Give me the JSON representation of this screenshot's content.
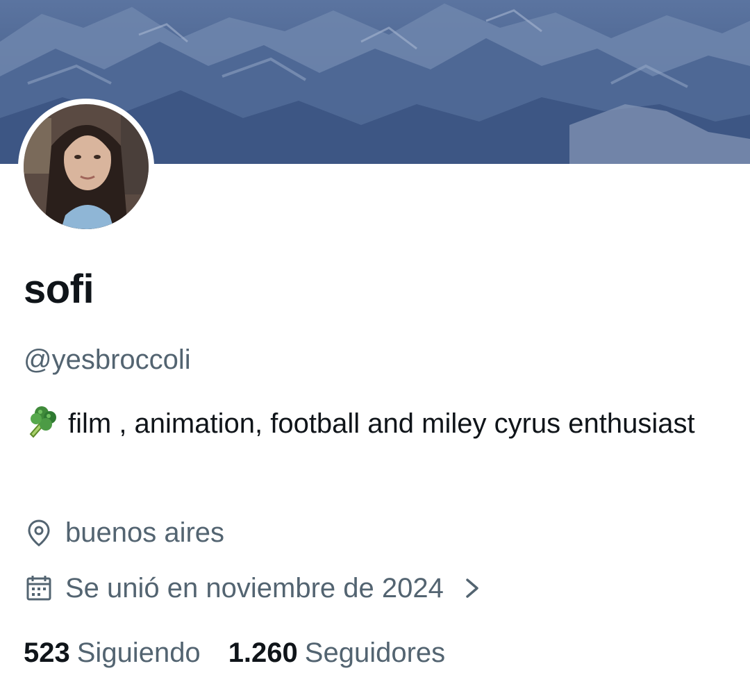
{
  "profile": {
    "display_name": "sofi",
    "handle": "@yesbroccoli",
    "bio": {
      "emoji_icon": "broccoli-emoji",
      "text": "film , animation, football and miley cyrus enthusiast"
    },
    "location": {
      "icon": "location-pin-icon",
      "text": "buenos aires"
    },
    "joined": {
      "icon": "calendar-icon",
      "text": "Se unió en noviembre de 2024",
      "chevron_icon": "chevron-right-icon"
    },
    "stats": {
      "following_count": "523",
      "following_label": "Siguiendo",
      "followers_count": "1.260",
      "followers_label": "Seguidores"
    }
  },
  "colors": {
    "primary_text": "#0f1419",
    "secondary_text": "#536471",
    "background": "#ffffff",
    "banner_tone": "#4a6590"
  }
}
